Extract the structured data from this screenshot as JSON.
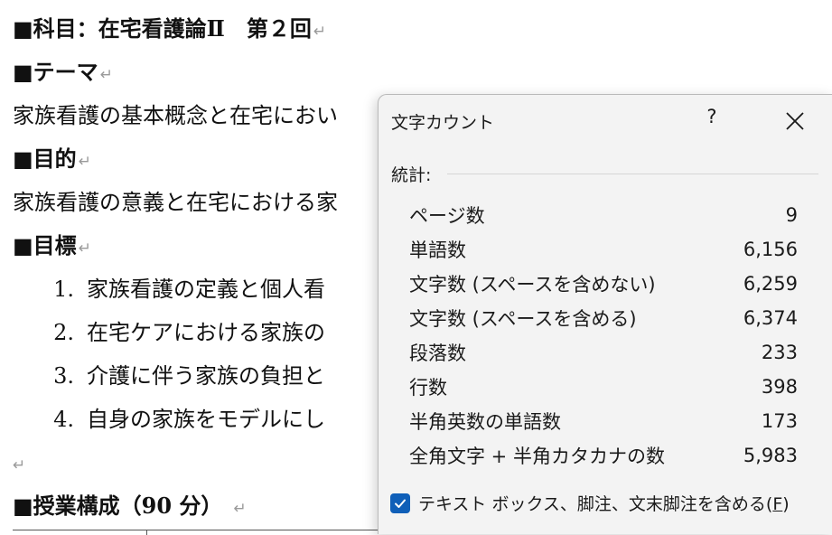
{
  "document": {
    "subject_line": "■科目：在宅看護論Ⅱ　第２回",
    "theme_heading": "■テーマ",
    "theme_text": "家族看護の基本概念と在宅におい",
    "purpose_heading": "■目的",
    "purpose_text": "家族看護の意義と在宅における家",
    "goals_heading": "■目標",
    "goals": [
      {
        "num": "1.",
        "text": "家族看護の定義と個人看"
      },
      {
        "num": "2.",
        "text": "在宅ケアにおける家族の"
      },
      {
        "num": "3.",
        "text": "介護に伴う家族の負担と"
      },
      {
        "num": "4.",
        "text": "自身の家族をモデルにし"
      }
    ],
    "class_structure_heading": "■授業構成（90 分）",
    "paragraph_mark": "↵"
  },
  "dialog": {
    "title": "文字カウント",
    "help_label": "?",
    "close_label": "×",
    "section_label": "統計:",
    "stats": [
      {
        "label": "ページ数",
        "value": "9"
      },
      {
        "label": "単語数",
        "value": "6,156"
      },
      {
        "label": "文字数 (スペースを含めない)",
        "value": "6,259"
      },
      {
        "label": "文字数 (スペースを含める)",
        "value": "6,374"
      },
      {
        "label": "段落数",
        "value": "233"
      },
      {
        "label": "行数",
        "value": "398"
      },
      {
        "label": "半角英数の単語数",
        "value": "173"
      },
      {
        "label": "全角文字 + 半角カタカナの数",
        "value": "5,983"
      }
    ],
    "checkbox_label": "テキスト ボックス、脚注、文末脚注を含める(",
    "checkbox_accesskey": "F",
    "checkbox_label_end": ")",
    "checkbox_checked": true,
    "accent_color": "#0f5fb8"
  }
}
